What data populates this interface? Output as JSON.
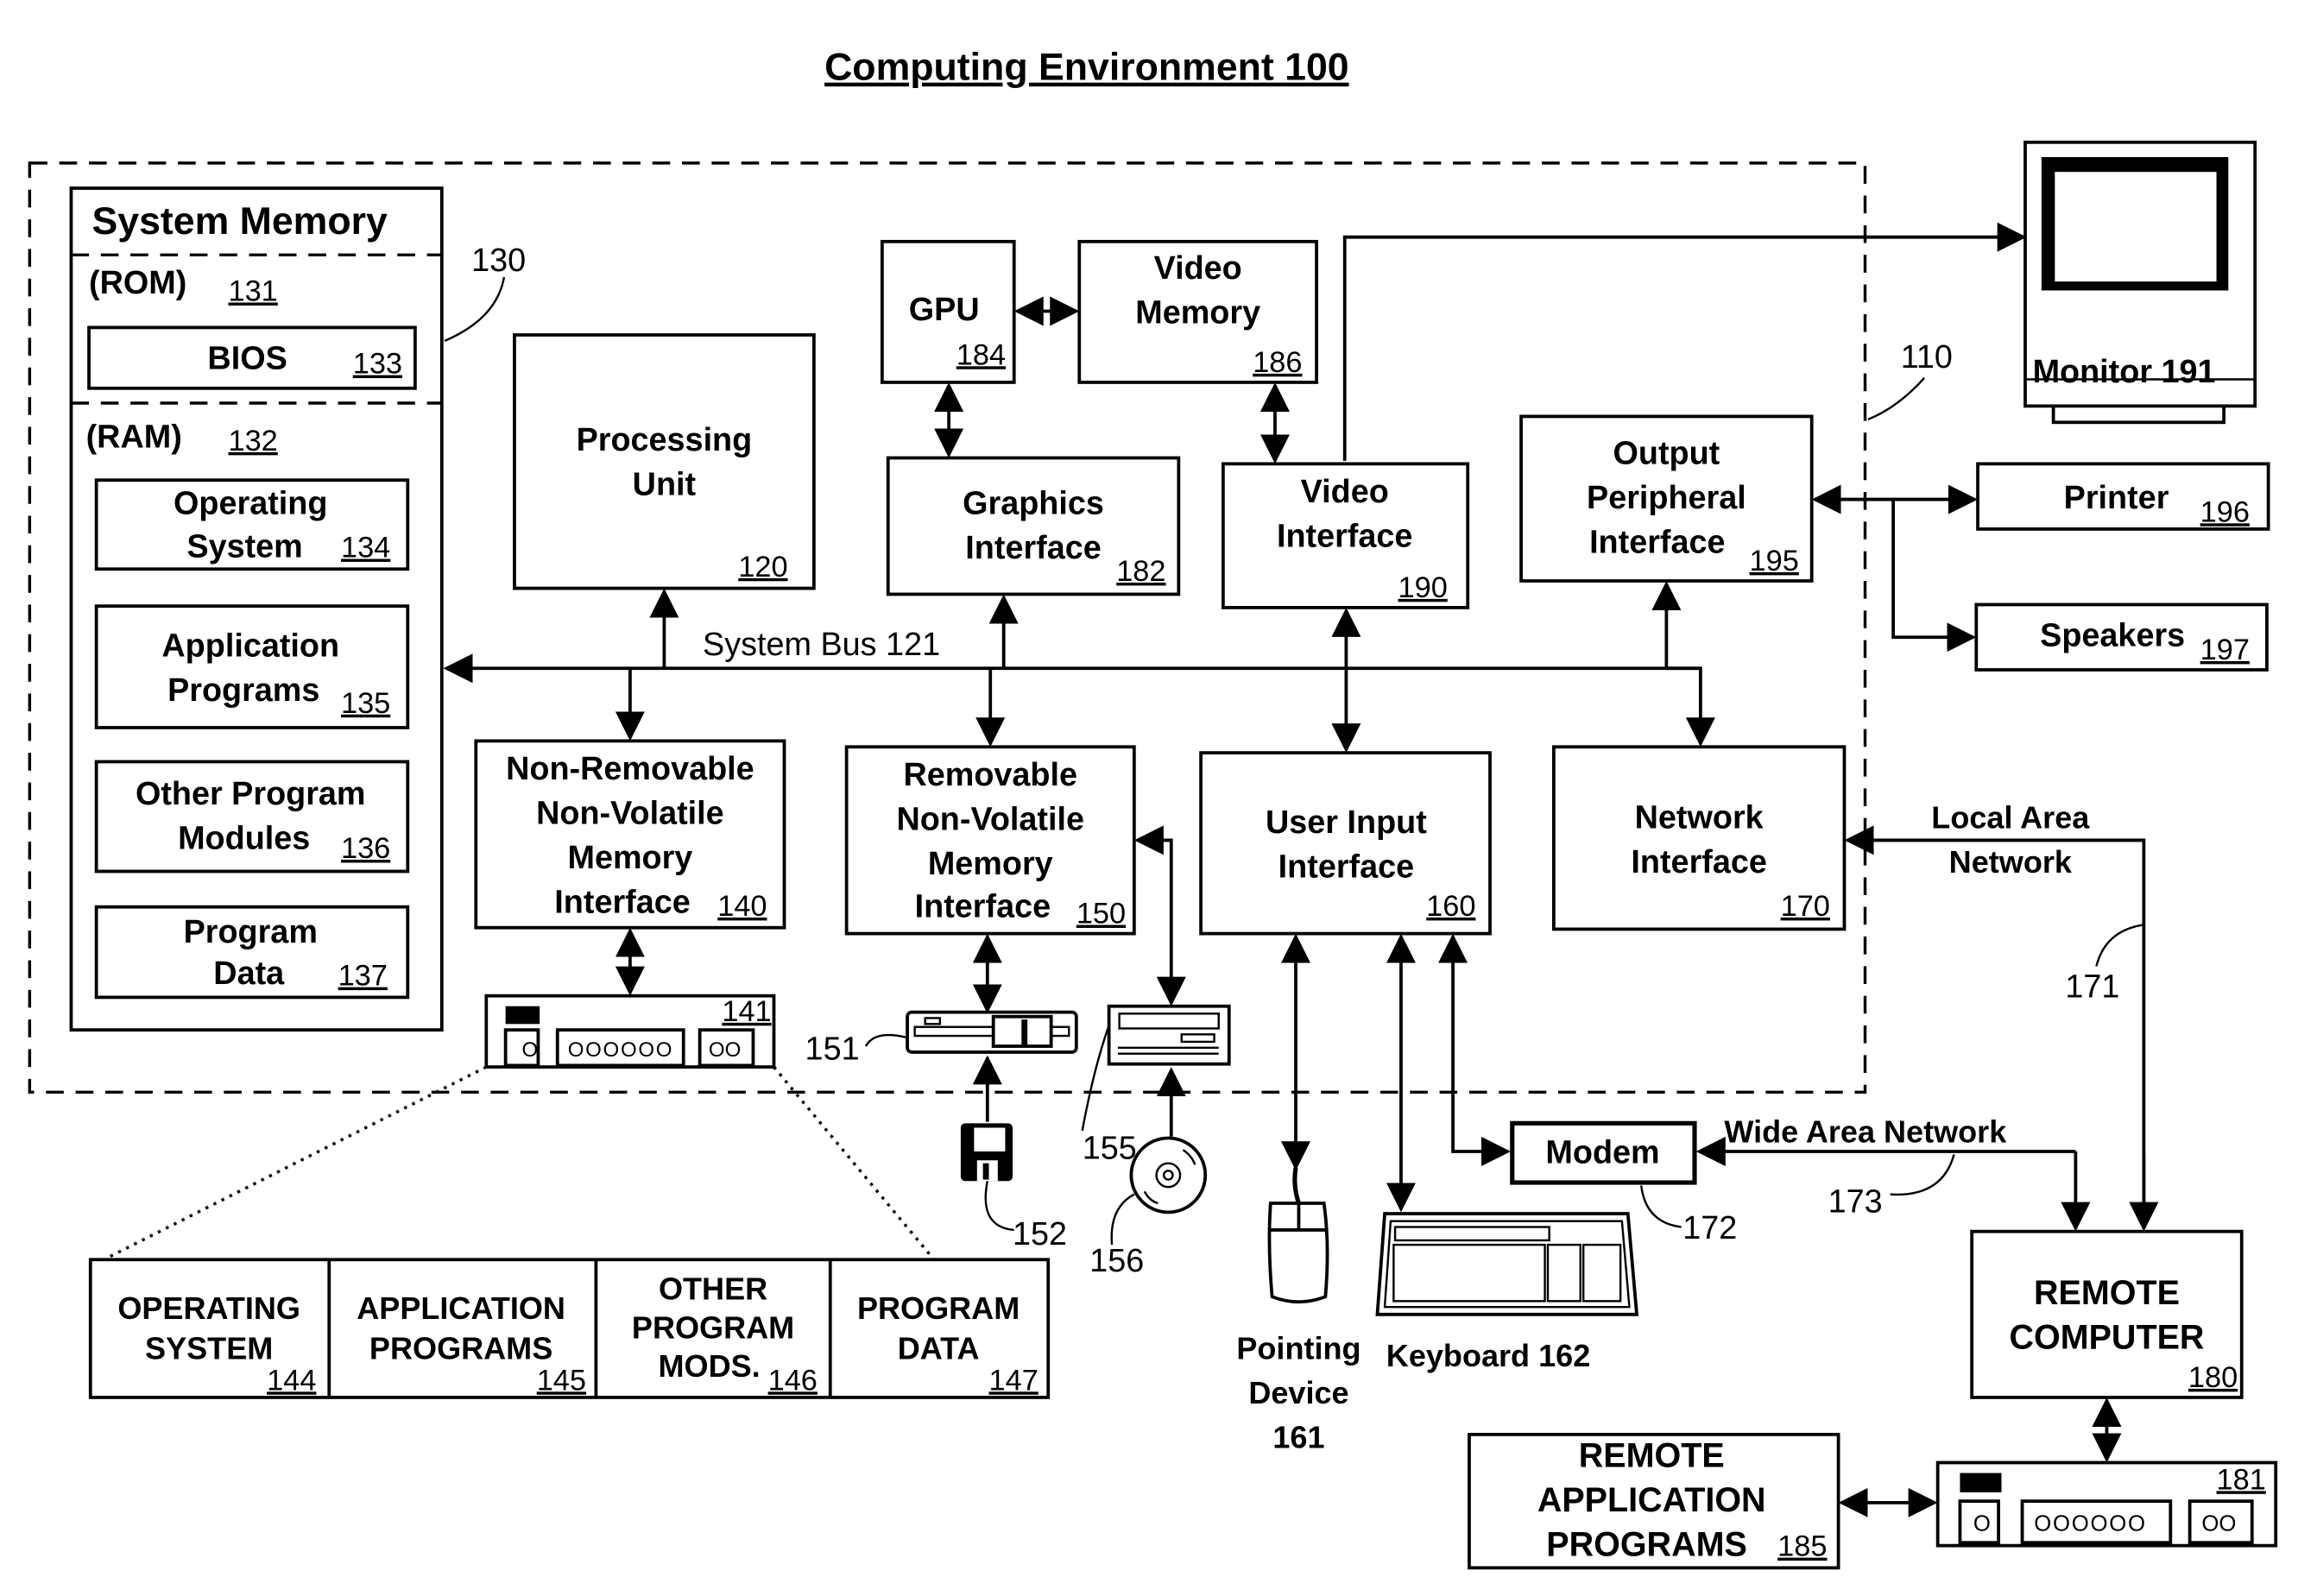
{
  "title": "Computing Environment 100",
  "refs": {
    "computer": "110",
    "system_memory": "130",
    "lan_link": "171",
    "wan_link": "173",
    "modem_ref": "172",
    "floppy_drive": "151",
    "floppy_disk": "152",
    "optical_drive": "155",
    "optical_disk": "156"
  },
  "system_memory": {
    "label": "System Memory",
    "rom": {
      "label": "(ROM)",
      "num": "131"
    },
    "bios": {
      "label": "BIOS",
      "num": "133"
    },
    "ram": {
      "label": "(RAM)",
      "num": "132"
    },
    "items": [
      {
        "line1": "Operating",
        "line2": "System",
        "num": "134"
      },
      {
        "line1": "Application",
        "line2": "Programs",
        "num": "135"
      },
      {
        "line1": "Other Program",
        "line2": "Modules",
        "num": "136"
      },
      {
        "line1": "Program",
        "line2": "Data",
        "num": "137"
      }
    ]
  },
  "processing_unit": {
    "line1": "Processing",
    "line2": "Unit",
    "num": "120"
  },
  "gpu": {
    "label": "GPU",
    "num": "184"
  },
  "video_memory": {
    "line1": "Video",
    "line2": "Memory",
    "num": "186"
  },
  "graphics_interface": {
    "line1": "Graphics",
    "line2": "Interface",
    "num": "182"
  },
  "video_interface": {
    "line1": "Video",
    "line2": "Interface",
    "num": "190"
  },
  "output_peripheral_interface": {
    "line1": "Output",
    "line2": "Peripheral",
    "line3": "Interface",
    "num": "195"
  },
  "system_bus": "System Bus 121",
  "non_removable": {
    "line1": "Non-Removable",
    "line2": "Non-Volatile",
    "line3": "Memory",
    "line4": "Interface",
    "num": "140"
  },
  "removable": {
    "line1": "Removable",
    "line2": "Non-Volatile",
    "line3": "Memory",
    "line4": "Interface",
    "num": "150"
  },
  "user_input_interface": {
    "line1": "User Input",
    "line2": "Interface",
    "num": "160"
  },
  "network_interface": {
    "line1": "Network",
    "line2": "Interface",
    "num": "170"
  },
  "hard_disk": {
    "num": "141",
    "slots": "OOOOOO",
    "pair": "OO",
    "single": "O"
  },
  "stored_items": [
    {
      "line1": "OPERATING",
      "line2": "SYSTEM",
      "line3": "",
      "num": "144"
    },
    {
      "line1": "APPLICATION",
      "line2": "PROGRAMS",
      "line3": "",
      "num": "145"
    },
    {
      "line1": "OTHER",
      "line2": "PROGRAM",
      "line3": "MODS.",
      "num": "146"
    },
    {
      "line1": "PROGRAM",
      "line2": "DATA",
      "line3": "",
      "num": "147"
    }
  ],
  "monitor": "Monitor 191",
  "printer": {
    "label": "Printer",
    "num": "196"
  },
  "speakers": {
    "label": "Speakers",
    "num": "197"
  },
  "lan": {
    "line1": "Local Area",
    "line2": "Network"
  },
  "wan": "Wide Area Network",
  "modem": "Modem",
  "pointing_device": {
    "line1": "Pointing",
    "line2": "Device",
    "line3": "161"
  },
  "keyboard": "Keyboard 162",
  "remote_computer": {
    "line1": "REMOTE",
    "line2": "COMPUTER",
    "num": "180"
  },
  "remote_apps": {
    "line1": "REMOTE",
    "line2": "APPLICATION",
    "line3": "PROGRAMS",
    "num": "185"
  },
  "remote_disk": {
    "num": "181",
    "slots": "OOOOOO",
    "pair": "OO",
    "single": "O"
  }
}
